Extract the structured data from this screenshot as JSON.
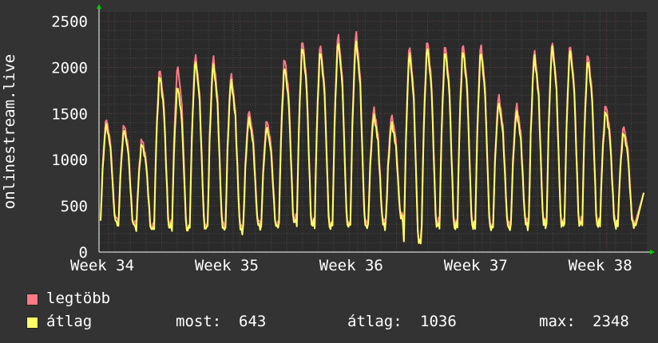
{
  "chart_data": {
    "type": "line",
    "ylabel": "onlinestream.live",
    "ylim": [
      0,
      2600
    ],
    "yticks": [
      0,
      500,
      1000,
      1500,
      2000,
      2500
    ],
    "x_ticks": [
      "Week 34",
      "Week 35",
      "Week 36",
      "Week 37",
      "Week 38"
    ],
    "grid": true,
    "colors": {
      "background": "#333333",
      "plot": "#2a2a2a",
      "grid": "#4a4a4a",
      "axis": "#ffffff",
      "arrow": "#00cc00",
      "max": "#ff7b84",
      "avg": "#ffff66"
    },
    "days": 35,
    "series": [
      {
        "name": "legtöbb",
        "key": "max",
        "peaks": [
          1470,
          1410,
          1250,
          2030,
          2060,
          2180,
          2160,
          1970,
          1560,
          1460,
          2150,
          2350,
          2300,
          2410,
          2430,
          1590,
          1510,
          2290,
          2350,
          2300,
          2310,
          2300,
          1730,
          1630,
          2230,
          2330,
          2300,
          2200,
          1630,
          1390
        ],
        "troughs": [
          360,
          310,
          270,
          310,
          270,
          300,
          310,
          270,
          320,
          300,
          360,
          330,
          310,
          330,
          320,
          320,
          400,
          120,
          320,
          310,
          320,
          300,
          300,
          320,
          330,
          320,
          330,
          330,
          340,
          330
        ]
      },
      {
        "name": "átlag",
        "key": "avg",
        "peaks": [
          1410,
          1350,
          1200,
          1960,
          1840,
          2120,
          2080,
          1900,
          1480,
          1380,
          2050,
          2280,
          2230,
          2330,
          2340,
          1510,
          1420,
          2210,
          2270,
          2230,
          2240,
          2220,
          1650,
          1550,
          2170,
          2280,
          2240,
          2130,
          1560,
          1320
        ],
        "troughs": [
          320,
          280,
          240,
          270,
          250,
          270,
          270,
          240,
          280,
          270,
          320,
          300,
          280,
          300,
          290,
          290,
          360,
          100,
          280,
          270,
          290,
          270,
          270,
          290,
          300,
          290,
          300,
          300,
          300,
          300
        ]
      }
    ],
    "legend": {
      "max_label": "legtöbb",
      "avg_label": "átlag",
      "stats": {
        "now_label": "most:",
        "now_value": "643",
        "avg_label": "átlag:",
        "avg_value": "1036",
        "max_label": "max:",
        "max_value": "2348"
      }
    }
  }
}
